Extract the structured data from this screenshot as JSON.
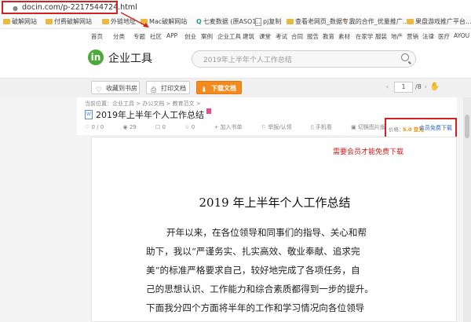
{
  "address_bar": {
    "url": "docin.com/p-2217544724.html"
  },
  "bookmarks": [
    {
      "label": "破解网站",
      "icon": "folder-icon"
    },
    {
      "label": "付费破解网站",
      "icon": "folder-icon"
    },
    {
      "label": "外链地址",
      "icon": "folder-icon"
    },
    {
      "label": "Mac破解网站",
      "icon": "folder-icon"
    },
    {
      "label": "七麦数据 (原ASO1...",
      "icon": "qimai-icon"
    },
    {
      "label": "pj复制",
      "icon": "file-icon"
    },
    {
      "label": "查看老网页_数据专...",
      "icon": "folder-icon"
    },
    {
      "label": "我的合作_优量推广...",
      "icon": "bird-icon"
    },
    {
      "label": "果盘游戏推广平台...",
      "icon": "folder-icon"
    }
  ],
  "top_nav": [
    "首页",
    "分类",
    "专题",
    "社区",
    "APP",
    "创业",
    "案例",
    "企业工具",
    "建筑",
    "课堂",
    "考试",
    "合同",
    "报告",
    "教育",
    "素材",
    "在家学",
    "服装",
    "地产",
    "营销",
    "法律",
    "医疗",
    "AYOU"
  ],
  "header": {
    "logo_mark": "in",
    "logo_text": "企业工具",
    "search_placeholder": "2019年上半年个人工作总结"
  },
  "toolbar": {
    "favorite_label": "收藏到书房",
    "print_label": "打印文档",
    "download_label": "下载文档",
    "page_current": "1",
    "page_total": "/8"
  },
  "doc_info": {
    "breadcrumb": "当前位置：企业工具 > 办公文档 > 教育范文 >",
    "title": "2019年上半年个人工作总结",
    "stats": [
      "0 / 0",
      "29",
      "0",
      "0",
      "加入书单",
      "举报/认领",
      "手机看",
      "切换图片版"
    ],
    "price_label": "价格：",
    "price_value": "5.0 豆元",
    "member_download": "会员免费下载"
  },
  "annotation_notice": "需要会员才能免费下载",
  "paper": {
    "title": "2019 年上半年个人工作总结",
    "lines": [
      "开年以来，在各位领导和同事们的指导、关心和帮",
      "助下，我以“严谨务实、扎实高效、敬业奉献、追求完",
      "美”的标准严格要求自己，较好地完成了各项任务，自",
      "己的思想认识、工作能力和综合素质都得到一步的提升。",
      "下面我分四个方面将半年的工作和学习情况向各位领导"
    ]
  },
  "colors": {
    "accent_orange": "#f28a1e",
    "logo_green": "#4caa3c",
    "annotation_red": "#d32020",
    "link_blue": "#2b6cd1"
  }
}
